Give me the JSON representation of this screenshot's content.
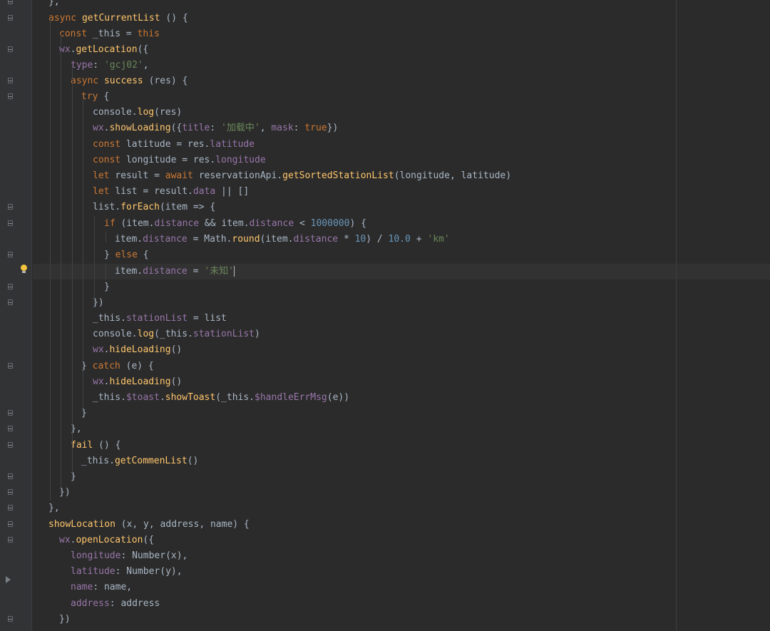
{
  "editor": {
    "theme_colors": {
      "background": "#2b2b2b",
      "gutter": "#313335",
      "keyword": "#cc7832",
      "function": "#ffc66d",
      "property": "#9876aa",
      "string": "#6a8759",
      "number": "#6897bb",
      "text": "#a9b7c6"
    },
    "lines": [
      {
        "id": "l0",
        "text": "},",
        "tokens": [
          {
            "t": "},",
            "c": "plain"
          }
        ]
      },
      {
        "id": "l1",
        "text": "async getCurrentList () {",
        "tokens": [
          {
            "t": "async ",
            "c": "kw"
          },
          {
            "t": "getCurrentList",
            "c": "fn"
          },
          {
            "t": " () {",
            "c": "plain"
          }
        ]
      },
      {
        "id": "l2",
        "text": "const _this = this",
        "tokens": [
          {
            "t": "const ",
            "c": "kw"
          },
          {
            "t": "_this = ",
            "c": "plain"
          },
          {
            "t": "this",
            "c": "kw"
          }
        ]
      },
      {
        "id": "l3",
        "text": "wx.getLocation({",
        "tokens": [
          {
            "t": "wx",
            "c": "prop"
          },
          {
            "t": ".",
            "c": "plain"
          },
          {
            "t": "getLocation",
            "c": "fn"
          },
          {
            "t": "({",
            "c": "plain"
          }
        ]
      },
      {
        "id": "l4",
        "text": "type: 'gcj02',",
        "tokens": [
          {
            "t": "type",
            "c": "prop"
          },
          {
            "t": ": ",
            "c": "plain"
          },
          {
            "t": "'gcj02'",
            "c": "str"
          },
          {
            "t": ",",
            "c": "plain"
          }
        ]
      },
      {
        "id": "l5",
        "text": "async success (res) {",
        "tokens": [
          {
            "t": "async ",
            "c": "kw"
          },
          {
            "t": "success",
            "c": "fn"
          },
          {
            "t": " (res) {",
            "c": "plain"
          }
        ]
      },
      {
        "id": "l6",
        "text": "try {",
        "tokens": [
          {
            "t": "try ",
            "c": "kw"
          },
          {
            "t": "{",
            "c": "plain"
          }
        ]
      },
      {
        "id": "l7",
        "text": "console.log(res)",
        "tokens": [
          {
            "t": "console.",
            "c": "plain"
          },
          {
            "t": "log",
            "c": "fn"
          },
          {
            "t": "(res)",
            "c": "plain"
          }
        ]
      },
      {
        "id": "l8",
        "text": "wx.showLoading({title: '加载中', mask: true})",
        "tokens": [
          {
            "t": "wx",
            "c": "prop"
          },
          {
            "t": ".",
            "c": "plain"
          },
          {
            "t": "showLoading",
            "c": "fn"
          },
          {
            "t": "({",
            "c": "plain"
          },
          {
            "t": "title",
            "c": "prop"
          },
          {
            "t": ": ",
            "c": "plain"
          },
          {
            "t": "'加载中'",
            "c": "str"
          },
          {
            "t": ", ",
            "c": "plain"
          },
          {
            "t": "mask",
            "c": "prop"
          },
          {
            "t": ": ",
            "c": "plain"
          },
          {
            "t": "true",
            "c": "kw"
          },
          {
            "t": "})",
            "c": "plain"
          }
        ]
      },
      {
        "id": "l9",
        "text": "const latitude = res.latitude",
        "tokens": [
          {
            "t": "const ",
            "c": "kw"
          },
          {
            "t": "latitude = res.",
            "c": "plain"
          },
          {
            "t": "latitude",
            "c": "prop"
          }
        ]
      },
      {
        "id": "l10",
        "text": "const longitude = res.longitude",
        "tokens": [
          {
            "t": "const ",
            "c": "kw"
          },
          {
            "t": "longitude = res.",
            "c": "plain"
          },
          {
            "t": "longitude",
            "c": "prop"
          }
        ]
      },
      {
        "id": "l11",
        "text": "let result = await reservationApi.getSortedStationList(longitude, latitude)",
        "tokens": [
          {
            "t": "let ",
            "c": "kw"
          },
          {
            "t": "result = ",
            "c": "plain"
          },
          {
            "t": "await ",
            "c": "kw"
          },
          {
            "t": "reservationApi.",
            "c": "plain"
          },
          {
            "t": "getSortedStationList",
            "c": "fn"
          },
          {
            "t": "(longitude, latitude)",
            "c": "plain"
          }
        ]
      },
      {
        "id": "l12",
        "text": "let list = result.data || []",
        "tokens": [
          {
            "t": "let ",
            "c": "kw"
          },
          {
            "t": "list = result.",
            "c": "plain"
          },
          {
            "t": "data",
            "c": "prop"
          },
          {
            "t": " || []",
            "c": "plain"
          }
        ]
      },
      {
        "id": "l13",
        "text": "list.forEach(item => {",
        "tokens": [
          {
            "t": "list.",
            "c": "plain"
          },
          {
            "t": "forEach",
            "c": "fn"
          },
          {
            "t": "(item => {",
            "c": "plain"
          }
        ]
      },
      {
        "id": "l14",
        "text": "if (item.distance && item.distance < 1000000) {",
        "tokens": [
          {
            "t": "if ",
            "c": "kw"
          },
          {
            "t": "(item.",
            "c": "plain"
          },
          {
            "t": "distance",
            "c": "prop"
          },
          {
            "t": " && item.",
            "c": "plain"
          },
          {
            "t": "distance",
            "c": "prop"
          },
          {
            "t": " < ",
            "c": "plain"
          },
          {
            "t": "1000000",
            "c": "num"
          },
          {
            "t": ") {",
            "c": "plain"
          }
        ]
      },
      {
        "id": "l15",
        "text": "item.distance = Math.round(item.distance * 10) / 10.0 + 'km'",
        "tokens": [
          {
            "t": "item.",
            "c": "plain"
          },
          {
            "t": "distance",
            "c": "prop"
          },
          {
            "t": " = Math.",
            "c": "plain"
          },
          {
            "t": "round",
            "c": "fn"
          },
          {
            "t": "(item.",
            "c": "plain"
          },
          {
            "t": "distance",
            "c": "prop"
          },
          {
            "t": " * ",
            "c": "plain"
          },
          {
            "t": "10",
            "c": "num"
          },
          {
            "t": ") / ",
            "c": "plain"
          },
          {
            "t": "10.0",
            "c": "num"
          },
          {
            "t": " + ",
            "c": "plain"
          },
          {
            "t": "'km'",
            "c": "str"
          }
        ]
      },
      {
        "id": "l16",
        "text": "} else {",
        "tokens": [
          {
            "t": "} ",
            "c": "plain"
          },
          {
            "t": "else ",
            "c": "kw"
          },
          {
            "t": "{",
            "c": "plain"
          }
        ]
      },
      {
        "id": "l17",
        "text": "item.distance = '未知'",
        "tokens": [
          {
            "t": "item.",
            "c": "plain"
          },
          {
            "t": "distance",
            "c": "prop"
          },
          {
            "t": " = ",
            "c": "plain"
          },
          {
            "t": "'未知'",
            "c": "str"
          }
        ]
      },
      {
        "id": "l18",
        "text": "}",
        "tokens": [
          {
            "t": "}",
            "c": "plain"
          }
        ]
      },
      {
        "id": "l19",
        "text": "})",
        "tokens": [
          {
            "t": "})",
            "c": "plain"
          }
        ]
      },
      {
        "id": "l20",
        "text": "_this.stationList = list",
        "tokens": [
          {
            "t": "_this.",
            "c": "plain"
          },
          {
            "t": "stationList",
            "c": "prop"
          },
          {
            "t": " = list",
            "c": "plain"
          }
        ]
      },
      {
        "id": "l21",
        "text": "console.log(_this.stationList)",
        "tokens": [
          {
            "t": "console.",
            "c": "plain"
          },
          {
            "t": "log",
            "c": "fn"
          },
          {
            "t": "(_this.",
            "c": "plain"
          },
          {
            "t": "stationList",
            "c": "prop"
          },
          {
            "t": ")",
            "c": "plain"
          }
        ]
      },
      {
        "id": "l22",
        "text": "wx.hideLoading()",
        "tokens": [
          {
            "t": "wx",
            "c": "prop"
          },
          {
            "t": ".",
            "c": "plain"
          },
          {
            "t": "hideLoading",
            "c": "fn"
          },
          {
            "t": "()",
            "c": "plain"
          }
        ]
      },
      {
        "id": "l23",
        "text": "} catch (e) {",
        "tokens": [
          {
            "t": "} ",
            "c": "plain"
          },
          {
            "t": "catch ",
            "c": "kw"
          },
          {
            "t": "(e) {",
            "c": "plain"
          }
        ]
      },
      {
        "id": "l24",
        "text": "wx.hideLoading()",
        "tokens": [
          {
            "t": "wx",
            "c": "prop"
          },
          {
            "t": ".",
            "c": "plain"
          },
          {
            "t": "hideLoading",
            "c": "fn"
          },
          {
            "t": "()",
            "c": "plain"
          }
        ]
      },
      {
        "id": "l25",
        "text": "_this.$toast.showToast(_this.$handleErrMsg(e))",
        "tokens": [
          {
            "t": "_this.",
            "c": "plain"
          },
          {
            "t": "$toast",
            "c": "prop"
          },
          {
            "t": ".",
            "c": "plain"
          },
          {
            "t": "showToast",
            "c": "fn"
          },
          {
            "t": "(_this.",
            "c": "plain"
          },
          {
            "t": "$handleErrMsg",
            "c": "prop"
          },
          {
            "t": "(e))",
            "c": "plain"
          }
        ]
      },
      {
        "id": "l26",
        "text": "}",
        "tokens": [
          {
            "t": "}",
            "c": "plain"
          }
        ]
      },
      {
        "id": "l27",
        "text": "},",
        "tokens": [
          {
            "t": "},",
            "c": "plain"
          }
        ]
      },
      {
        "id": "l28",
        "text": "fail () {",
        "tokens": [
          {
            "t": "fail",
            "c": "fn"
          },
          {
            "t": " () {",
            "c": "plain"
          }
        ]
      },
      {
        "id": "l29",
        "text": "_this.getCommenList()",
        "tokens": [
          {
            "t": "_this.",
            "c": "plain"
          },
          {
            "t": "getCommenList",
            "c": "fn"
          },
          {
            "t": "()",
            "c": "plain"
          }
        ]
      },
      {
        "id": "l30",
        "text": "}",
        "tokens": [
          {
            "t": "}",
            "c": "plain"
          }
        ]
      },
      {
        "id": "l31",
        "text": "})",
        "tokens": [
          {
            "t": "})",
            "c": "plain"
          }
        ]
      },
      {
        "id": "l32",
        "text": "},",
        "tokens": [
          {
            "t": "},",
            "c": "plain"
          }
        ]
      },
      {
        "id": "l33",
        "text": "showLocation (x, y, address, name) {",
        "tokens": [
          {
            "t": "showLocation",
            "c": "fn"
          },
          {
            "t": " (x, y, address, name) {",
            "c": "plain"
          }
        ]
      },
      {
        "id": "l34",
        "text": "wx.openLocation({",
        "tokens": [
          {
            "t": "wx",
            "c": "prop"
          },
          {
            "t": ".",
            "c": "plain"
          },
          {
            "t": "openLocation",
            "c": "fn"
          },
          {
            "t": "({",
            "c": "plain"
          }
        ]
      },
      {
        "id": "l35",
        "text": "longitude: Number(x),",
        "tokens": [
          {
            "t": "longitude",
            "c": "prop"
          },
          {
            "t": ": Number(x),",
            "c": "plain"
          }
        ]
      },
      {
        "id": "l36",
        "text": "latitude: Number(y),",
        "tokens": [
          {
            "t": "latitude",
            "c": "prop"
          },
          {
            "t": ": Number(y),",
            "c": "plain"
          }
        ]
      },
      {
        "id": "l37",
        "text": "name: name,",
        "tokens": [
          {
            "t": "name",
            "c": "prop"
          },
          {
            "t": ": name,",
            "c": "plain"
          }
        ]
      },
      {
        "id": "l38",
        "text": "address: address",
        "tokens": [
          {
            "t": "address",
            "c": "prop"
          },
          {
            "t": ": address",
            "c": "plain"
          }
        ]
      },
      {
        "id": "l39",
        "text": "})",
        "tokens": [
          {
            "t": "})",
            "c": "plain"
          }
        ]
      }
    ]
  }
}
